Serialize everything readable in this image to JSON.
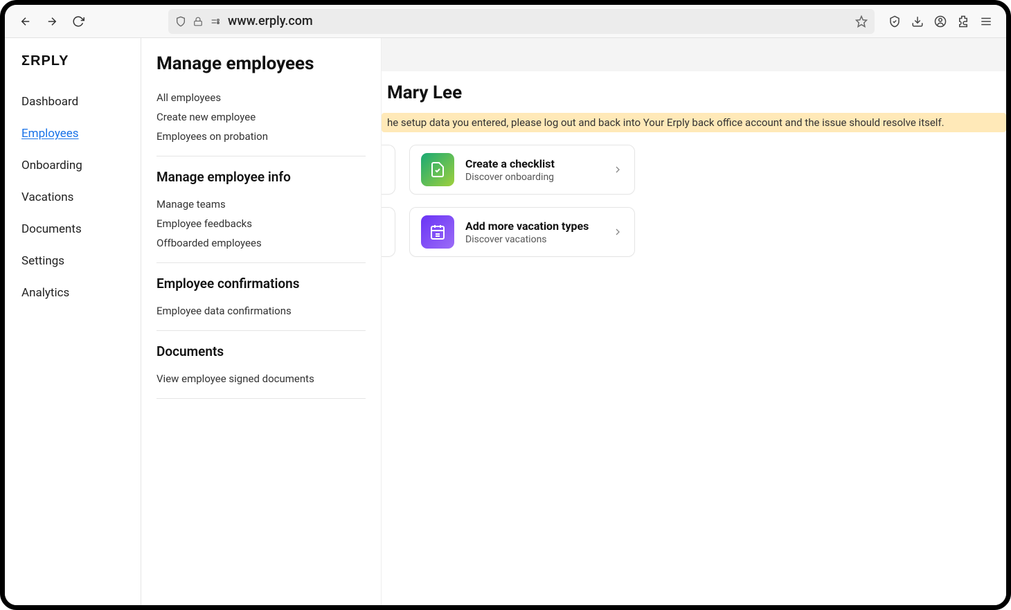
{
  "browser": {
    "url": "www.erply.com"
  },
  "logo": "ΣRPLY",
  "sidebar_primary": [
    {
      "label": "Dashboard",
      "active": false
    },
    {
      "label": "Employees",
      "active": true
    },
    {
      "label": "Onboarding",
      "active": false
    },
    {
      "label": "Vacations",
      "active": false
    },
    {
      "label": "Documents",
      "active": false
    },
    {
      "label": "Settings",
      "active": false
    },
    {
      "label": "Analytics",
      "active": false
    }
  ],
  "secondary": {
    "title": "Manage employees",
    "sections": [
      {
        "heading": null,
        "links": [
          "All employees",
          "Create new employee",
          "Employees on probation"
        ]
      },
      {
        "heading": "Manage employee info",
        "links": [
          "Manage teams",
          "Employee feedbacks",
          "Offboarded employees"
        ]
      },
      {
        "heading": "Employee confirmations",
        "links": [
          "Employee data confirmations"
        ]
      },
      {
        "heading": "Documents",
        "links": [
          "View employee signed documents"
        ]
      }
    ]
  },
  "main": {
    "header": "Mary Lee",
    "alert": "he setup data you entered, please log out and back into Your Erply back office account and the issue should resolve itself.",
    "cards": [
      {
        "title": "Create a checklist",
        "subtitle": "Discover onboarding",
        "icon": "checklist",
        "color": "green"
      },
      {
        "title": "Add more vacation types",
        "subtitle": "Discover vacations",
        "icon": "calendar",
        "color": "purple"
      }
    ]
  }
}
